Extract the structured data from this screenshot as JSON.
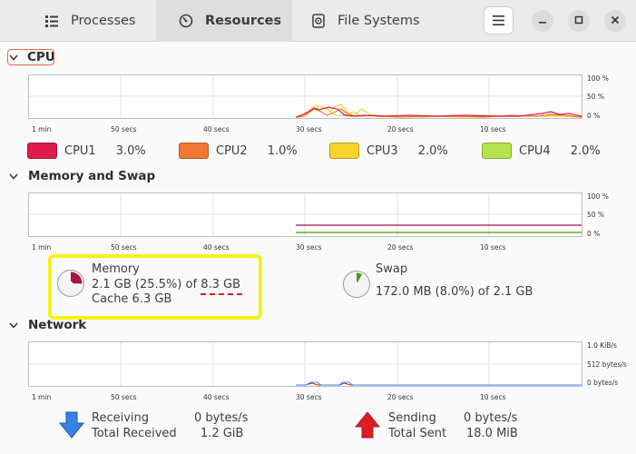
{
  "tabs": [
    {
      "label": "Processes",
      "icon": "list-icon"
    },
    {
      "label": "Resources",
      "icon": "gauge-icon"
    },
    {
      "label": "File Systems",
      "icon": "disk-icon"
    }
  ],
  "sections": {
    "cpu": "CPU",
    "memory": "Memory and Swap",
    "network": "Network"
  },
  "x_labels": [
    "1 min",
    "50 secs",
    "40 secs",
    "30 secs",
    "20 secs",
    "10 secs"
  ],
  "y_labels_percent": [
    "100 %",
    "50 %",
    "0 %"
  ],
  "y_labels_network": [
    "1.0 KiB/s",
    "512 bytes/s",
    "0 bytes/s"
  ],
  "cpus": [
    {
      "name": "CPU1",
      "value": "3.0%",
      "color": "#e01b4c"
    },
    {
      "name": "CPU2",
      "value": "1.0%",
      "color": "#f27835"
    },
    {
      "name": "CPU3",
      "value": "2.0%",
      "color": "#f6d32d"
    },
    {
      "name": "CPU4",
      "value": "2.0%",
      "color": "#b5e34d"
    }
  ],
  "memory": {
    "label": "Memory",
    "used": "2.1 GB (25.5%) of",
    "total": "8.3 GB",
    "cache": "Cache 6.3 GB",
    "percent": 25.5,
    "color": "#a6144a"
  },
  "swap": {
    "label": "Swap",
    "value": "172.0 MB (8.0%) of 2.1 GB",
    "percent": 8.0,
    "color": "#4e9a06"
  },
  "network": {
    "receiving_label": "Receiving",
    "receiving_value": "0 bytes/s",
    "total_received_label": "Total Received",
    "total_received_value": "1.2 GiB",
    "sending_label": "Sending",
    "sending_value": "0 bytes/s",
    "total_sent_label": "Total Sent",
    "total_sent_value": "18.0 MiB"
  },
  "colors": {
    "highlight": "#f4f21c",
    "annotation_underline": "#e01b24"
  }
}
